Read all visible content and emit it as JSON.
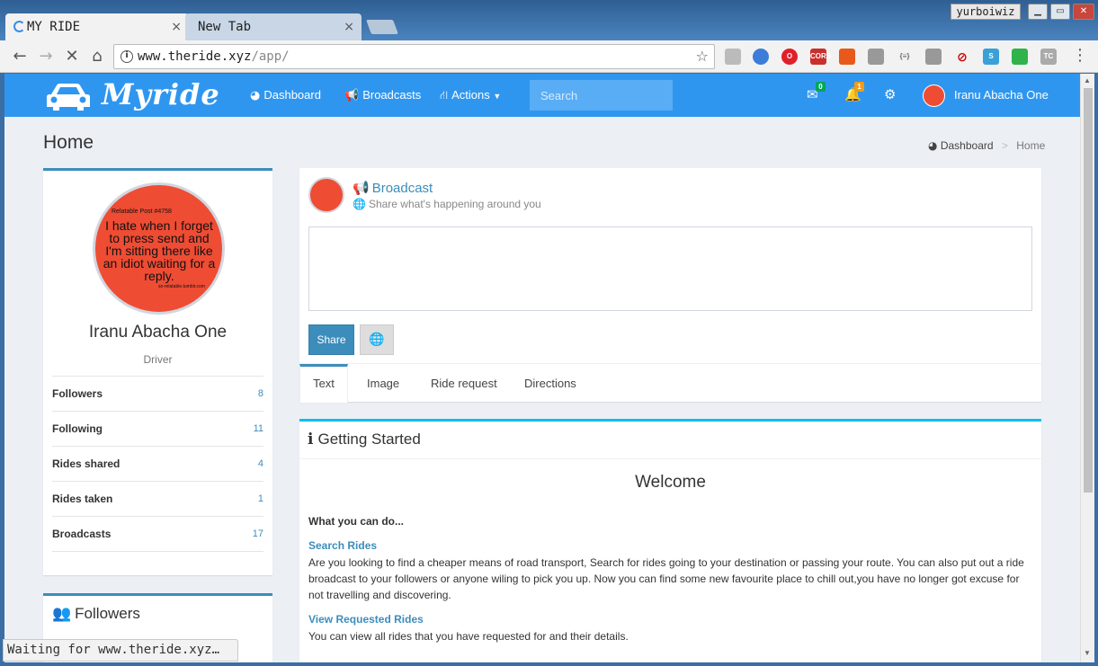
{
  "browser": {
    "tabs": [
      {
        "label": "MY RIDE",
        "active": true
      },
      {
        "label": "New Tab",
        "active": false
      }
    ],
    "profile": "yurboiwiz",
    "url_domain": "www.theride.xyz",
    "url_path": "/app/",
    "status_text": "Waiting for www.theride.xyz…"
  },
  "header": {
    "logo": "Myride",
    "nav": [
      {
        "label": "Dashboard",
        "icon": "dashboard-icon"
      },
      {
        "label": "Broadcasts",
        "icon": "bullhorn-icon"
      },
      {
        "label": "Actions",
        "icon": "road-icon"
      }
    ],
    "search_placeholder": "Search",
    "messages_count": "0",
    "notifications_count": "1",
    "user_name": "Iranu Abacha One",
    "accent": "#2f96f0"
  },
  "content_header": {
    "title": "Home",
    "breadcrumb": [
      "Dashboard",
      "Home"
    ]
  },
  "profile": {
    "avatar_text": "I hate when I forget to press send and I'm sitting there like an idiot waiting for a reply.",
    "avatar_tag": "Relatable Post #4758",
    "avatar_credit": "so-relatable.tumblr.com",
    "name": "Iranu Abacha One",
    "role": "Driver",
    "stats": [
      {
        "label": "Followers",
        "value": "8"
      },
      {
        "label": "Following",
        "value": "11"
      },
      {
        "label": "Rides shared",
        "value": "4"
      },
      {
        "label": "Rides taken",
        "value": "1"
      },
      {
        "label": "Broadcasts",
        "value": "17"
      }
    ]
  },
  "followers_box": {
    "title": "Followers"
  },
  "broadcast": {
    "title": "Broadcast",
    "subtitle": "Share what's happening around you",
    "share_label": "Share",
    "tabs": [
      "Text",
      "Image",
      "Ride request",
      "Directions"
    ]
  },
  "getting_started": {
    "title": "Getting Started",
    "welcome": "Welcome",
    "what_label": "What you can do...",
    "sections": [
      {
        "link": "Search Rides",
        "text": "Are you looking to find a cheaper means of road transport, Search for rides going to your destination or passing your route. You can also put out a ride broadcast to your followers or anyone wiling to pick you up. Now you can find some new favourite place to chill out,you have no longer got excuse for not travelling and discovering."
      },
      {
        "link": "View Requested Rides",
        "text": "You can view all rides that you have requested for and their details."
      }
    ]
  }
}
